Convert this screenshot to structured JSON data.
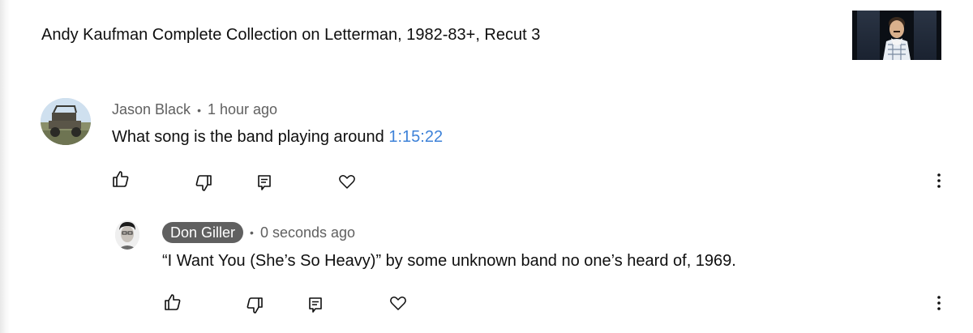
{
  "video": {
    "title": "Andy Kaufman Complete Collection on Letterman, 1982-83+, Recut 3",
    "thumbnail_icon": "video-thumbnail"
  },
  "comments": [
    {
      "author": "Jason Black",
      "time": "1 hour ago",
      "text": "What song is the band playing around ",
      "timestamp_link": "1:15:22",
      "avatar": "jeep-photo-avatar",
      "actions": [
        "thumbs-up-icon",
        "thumbs-down-icon",
        "reply-icon",
        "heart-icon",
        "more-vert-icon"
      ]
    },
    {
      "author": "Don Giller",
      "time": "0 seconds ago",
      "text": "“I Want You (She’s So Heavy)” by some unknown band no one’s heard of, 1969.",
      "avatar": "profile-photo-avatar",
      "actions": [
        "thumbs-up-icon",
        "thumbs-down-icon",
        "reply-icon",
        "heart-icon",
        "more-vert-icon"
      ]
    }
  ],
  "colors": {
    "text_primary": "#0f0f0f",
    "text_secondary": "#606060",
    "link": "#3e82d8",
    "author_chip_bg": "#606060"
  }
}
